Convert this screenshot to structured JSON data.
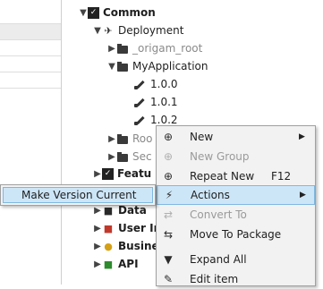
{
  "left_pane": {
    "header": ""
  },
  "tree": {
    "common": "Common",
    "deployment": "Deployment",
    "origam_root": "_origam_root",
    "my_application": "MyApplication",
    "versions": [
      "1.0.0",
      "1.0.1",
      "1.0.2"
    ],
    "partial_roo": "Roo",
    "partial_sec": "Sec",
    "partial_featu": "Featu",
    "partial_data": "Data",
    "partial_user": "User Inte",
    "partial_business": "Business",
    "api": "API"
  },
  "context_menu": {
    "new": "New",
    "new_group": "New Group",
    "repeat_new": "Repeat New",
    "repeat_new_shortcut": "F12",
    "actions": "Actions",
    "convert_to": "Convert To",
    "move_to_package": "Move To Package",
    "expand_all": "Expand All",
    "edit_item": "Edit item"
  },
  "submenu": {
    "make_version_current": "Make Version Current"
  },
  "colors": {
    "selection": "#cde6f7",
    "selection_border": "#99d1ff",
    "menu_bg": "#f2f2f2"
  }
}
